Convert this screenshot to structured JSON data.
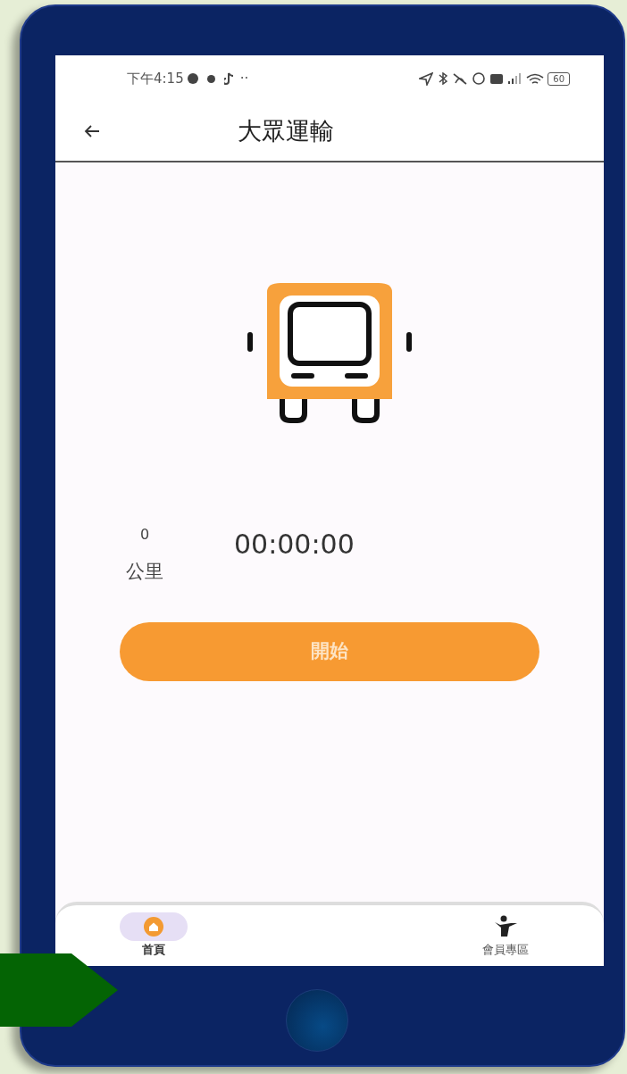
{
  "status_bar": {
    "time": "下午4:15",
    "dots": "··",
    "battery": "60"
  },
  "header": {
    "title": "大眾運輸"
  },
  "stats": {
    "distance": "0",
    "distance_unit": "公里",
    "duration": "00:00:00"
  },
  "start_button": {
    "label": "開始"
  },
  "bottom_nav": [
    {
      "label": "首頁",
      "kind": "home",
      "selected": true
    },
    {
      "label": "會員專區",
      "kind": "member",
      "selected": false
    }
  ]
}
